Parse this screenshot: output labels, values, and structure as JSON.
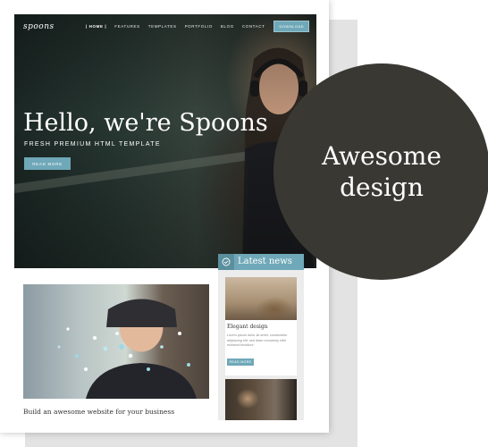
{
  "header": {
    "logo": "spoons",
    "nav": [
      "| HOME |",
      "FEATURES",
      "TEMPLATES",
      "PORTFOLIO",
      "BLOG",
      "CONTACT"
    ],
    "nav_button": "DOWNLOAD"
  },
  "hero": {
    "title": "Hello, we're Spoons",
    "subtitle": "FRESH PREMIUM HTML TEMPLATE",
    "button": "READ MORE"
  },
  "content": {
    "caption": "Build an awesome website for your business"
  },
  "news": {
    "title": "Latest news",
    "item1": {
      "title": "Elegant design",
      "text": "Lorem ipsum dolor sit amet, consectetur adipiscing elit, sed diam nonummy nibh euismod tincidunt",
      "button": "READ MORE"
    }
  },
  "bubble": {
    "text": "Awesome design"
  },
  "colors": {
    "accent": "#6fa8b8",
    "bubble": "#3a3833"
  }
}
